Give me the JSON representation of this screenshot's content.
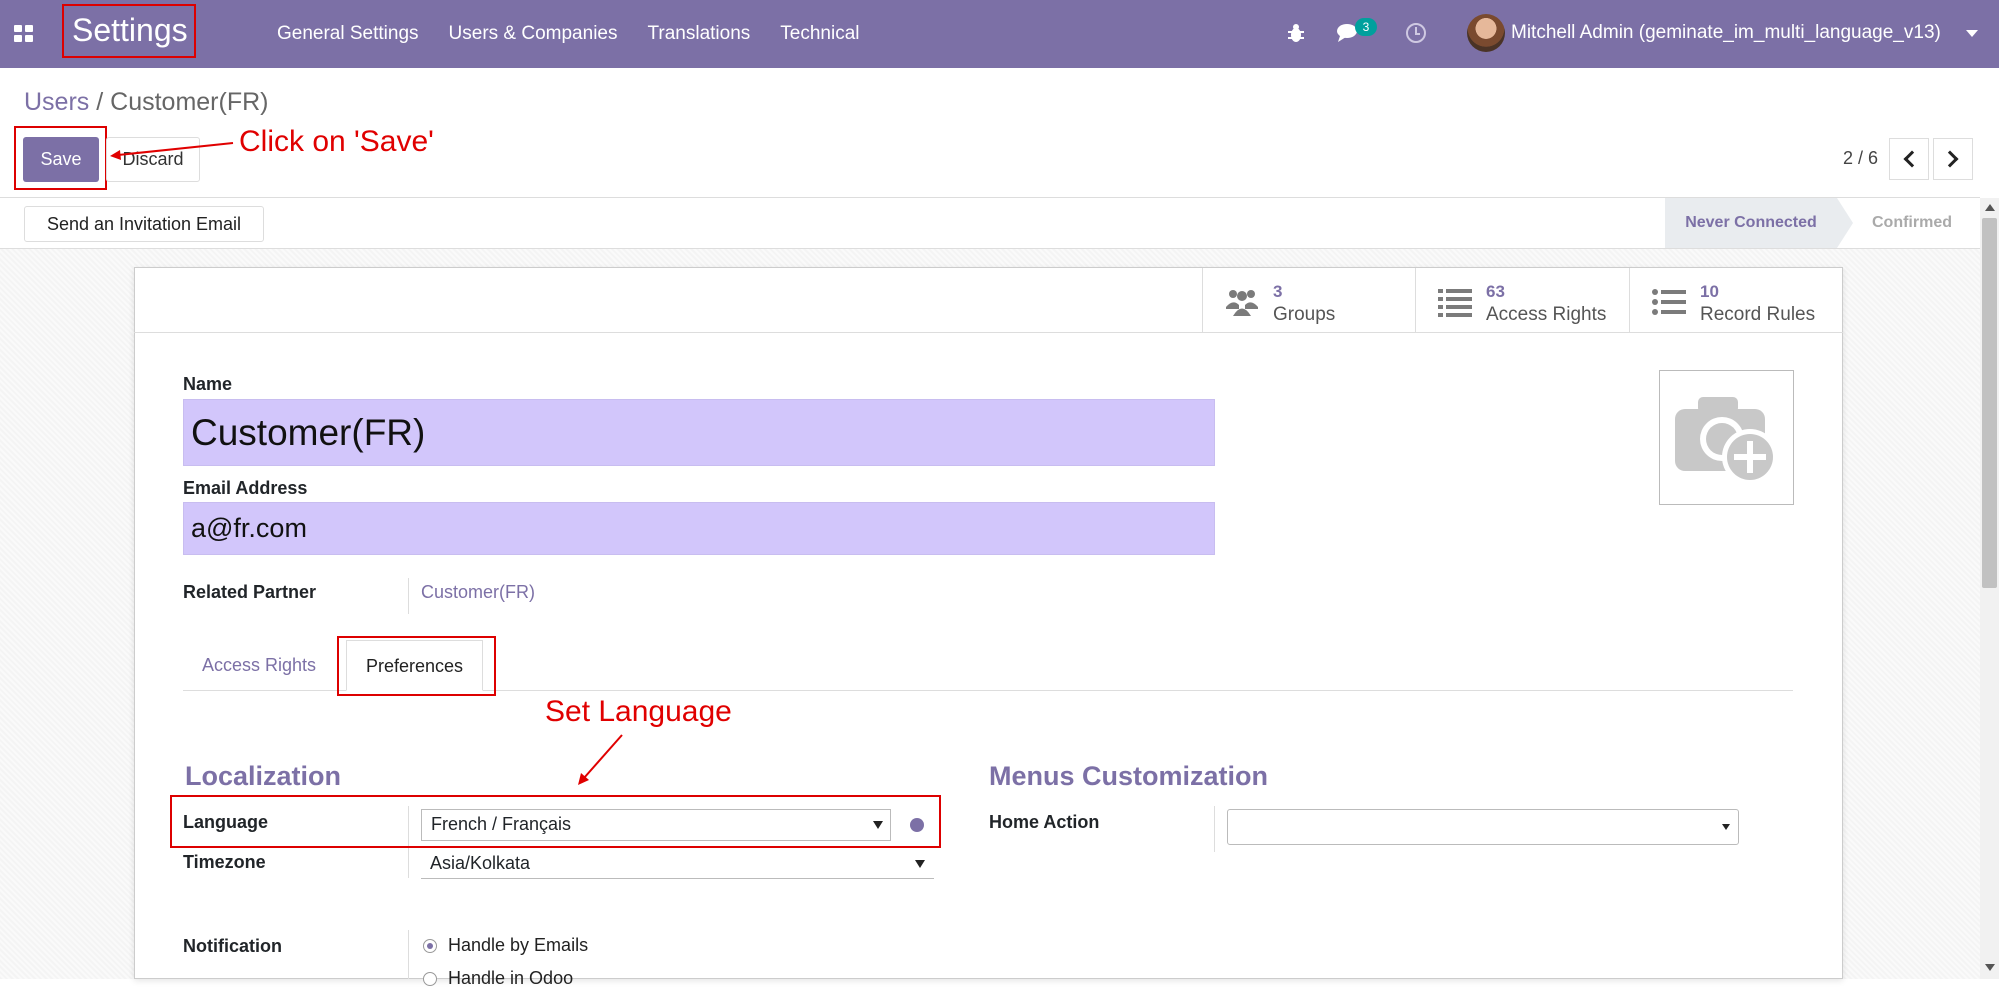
{
  "navbar": {
    "brand": "Settings",
    "menu": [
      "General Settings",
      "Users & Companies",
      "Translations",
      "Technical"
    ],
    "chat_badge": "3",
    "user": "Mitchell Admin (geminate_im_multi_language_v13)"
  },
  "breadcrumb": {
    "parent": "Users",
    "separator": " / ",
    "current": "Customer(FR)"
  },
  "buttons": {
    "save": "Save",
    "discard": "Discard",
    "invite": "Send an Invitation Email"
  },
  "pager": {
    "value": "2 / 6"
  },
  "status": {
    "active": "Never Connected",
    "next": "Confirmed"
  },
  "smart_buttons": [
    {
      "count": "3",
      "label": "Groups",
      "icon": "users-icon"
    },
    {
      "count": "63",
      "label": "Access Rights",
      "icon": "list-icon"
    },
    {
      "count": "10",
      "label": "Record Rules",
      "icon": "list-icon"
    }
  ],
  "form": {
    "name_label": "Name",
    "name_value": "Customer(FR)",
    "email_label": "Email Address",
    "email_value": "a@fr.com",
    "partner_label": "Related Partner",
    "partner_value": "Customer(FR)"
  },
  "tabs": [
    "Access Rights",
    "Preferences"
  ],
  "preferences": {
    "localization_title": "Localization",
    "language_label": "Language",
    "language_value": "French / Français",
    "timezone_label": "Timezone",
    "timezone_value": "Asia/Kolkata",
    "menus_title": "Menus Customization",
    "home_action_label": "Home Action",
    "home_action_value": "",
    "notification_label": "Notification",
    "notification_options": [
      "Handle by Emails",
      "Handle in Odoo"
    ]
  },
  "annotations": {
    "save": "Click on 'Save'",
    "language": "Set Language"
  },
  "colors": {
    "brand": "#7c70a6",
    "input_required": "#d2c6fb",
    "annotation": "#e00000",
    "badge": "#00a09d"
  }
}
